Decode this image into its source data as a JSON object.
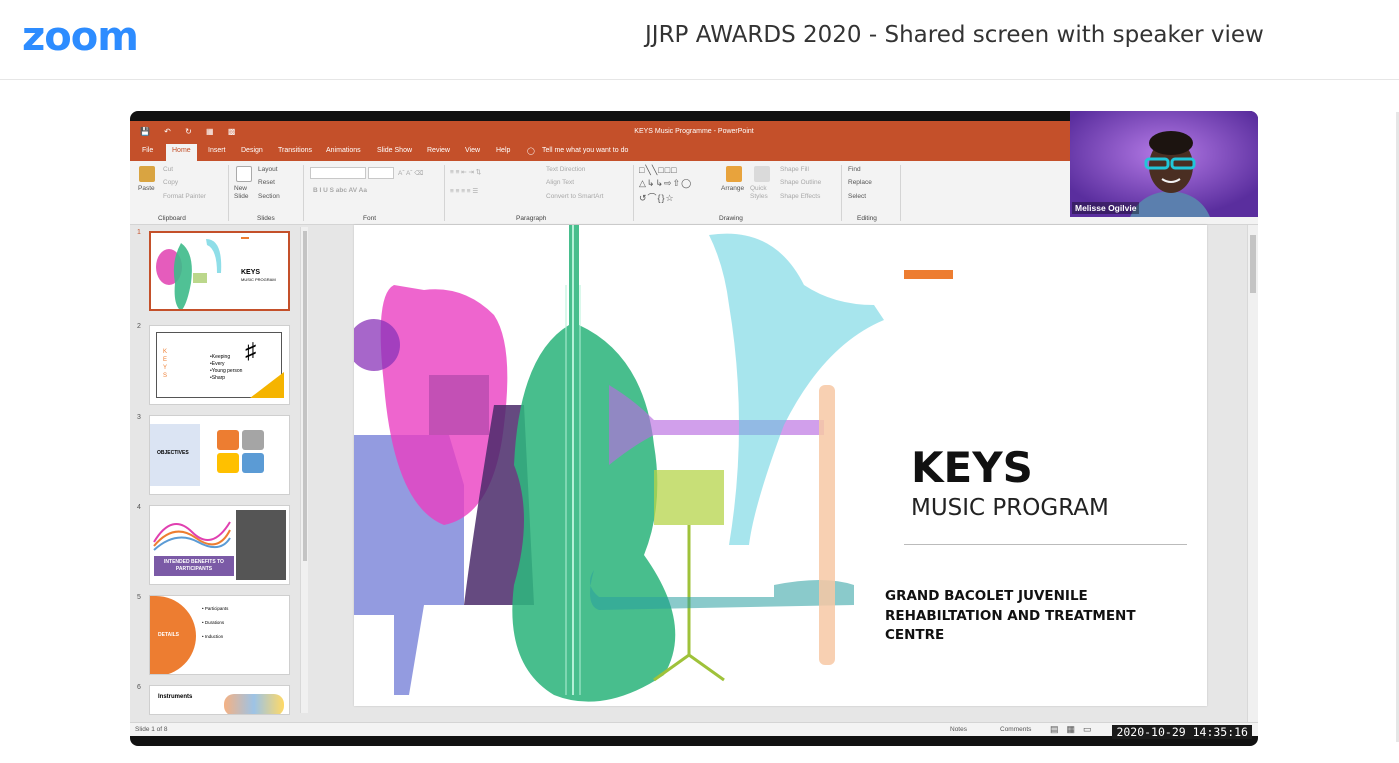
{
  "header": {
    "logo": "zoom",
    "title": "JJRP AWARDS 2020 - Shared screen with speaker view"
  },
  "powerpoint": {
    "window_title": "KEYS Music Programme - PowerPoint",
    "tabs": [
      "File",
      "Home",
      "Insert",
      "Design",
      "Transitions",
      "Animations",
      "Slide Show",
      "Review",
      "View",
      "Help"
    ],
    "tell_me": "Tell me what you want to do",
    "ribbon": {
      "paste": "Paste",
      "cut": "Cut",
      "copy": "Copy",
      "format_painter": "Format Painter",
      "clipboard": "Clipboard",
      "new_slide": "New Slide",
      "layout": "Layout",
      "reset": "Reset",
      "section": "Section",
      "slides": "Slides",
      "font_buttons": "B  I  U  S  abc  AV  Aa",
      "font": "Font",
      "text_direction": "Text Direction",
      "align_text": "Align Text",
      "convert_smartart": "Convert to SmartArt",
      "paragraph": "Paragraph",
      "arrange": "Arrange",
      "quick_styles": "Quick Styles",
      "shape_fill": "Shape Fill",
      "shape_outline": "Shape Outline",
      "shape_effects": "Shape Effects",
      "drawing": "Drawing",
      "find": "Find",
      "replace": "Replace",
      "select": "Select",
      "editing": "Editing"
    },
    "thumbnails": [
      {
        "number": "1",
        "title": "KEYS",
        "subtitle": "MUSIC PROGRAM"
      },
      {
        "number": "2",
        "letters": "K E Y S",
        "bullets": [
          "•Keeping",
          "•Every",
          "•Young person",
          "•Sharp"
        ]
      },
      {
        "number": "3",
        "label": "OBJECTIVES"
      },
      {
        "number": "4",
        "label": "INTENDED BENEFITS TO PARTICIPANTS"
      },
      {
        "number": "5",
        "label": "DETAILS",
        "bullets": [
          "• Participants",
          "• Durations",
          "• Induction"
        ]
      },
      {
        "number": "6",
        "label": "Instruments"
      }
    ],
    "slide": {
      "title": "KEYS",
      "subtitle": "MUSIC PROGRAM",
      "organization": "GRAND BACOLET JUVENILE REHABILTATION AND TREATMENT CENTRE",
      "accent_color": "#ed7d31"
    },
    "status": {
      "slide_count": "Slide 1 of 8",
      "notes": "Notes",
      "comments": "Comments"
    }
  },
  "speaker": {
    "name": "Melisse Ogilvie"
  },
  "timestamp": "2020-10-29  14:35:16"
}
